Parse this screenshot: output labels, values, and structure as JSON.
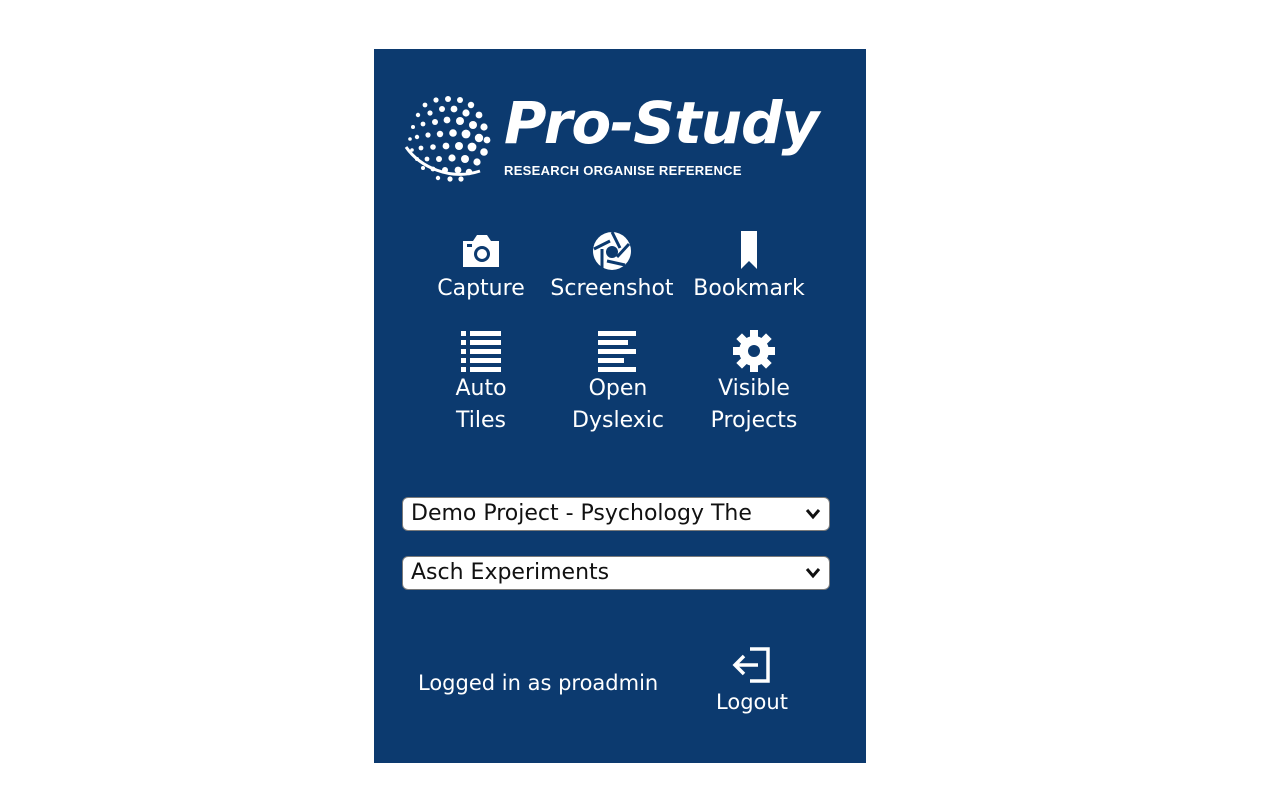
{
  "brand": {
    "title": "Pro-Study",
    "tagline": "RESEARCH ORGANISE REFERENCE"
  },
  "tools": {
    "capture": {
      "label": "Capture",
      "icon": "camera-icon"
    },
    "screenshot": {
      "label": "Screenshot",
      "icon": "aperture-icon"
    },
    "bookmark": {
      "label": "Bookmark",
      "icon": "bookmark-icon"
    },
    "auto_tiles": {
      "label_line1": "Auto",
      "label_line2": "Tiles",
      "icon": "list-icon"
    },
    "open_dyslexic": {
      "label_line1": "Open",
      "label_line2": "Dyslexic",
      "icon": "text-align-icon"
    },
    "visible_projects": {
      "label_line1": "Visible",
      "label_line2": "Projects",
      "icon": "gear-icon"
    }
  },
  "project_select": {
    "value": "Demo Project - Psychology The"
  },
  "topic_select": {
    "value": "Asch Experiments"
  },
  "footer": {
    "status": "Logged in as proadmin",
    "logout_label": "Logout",
    "logout_icon": "logout-icon"
  },
  "colors": {
    "panel_bg": "#0c3a6f",
    "text": "#ffffff"
  }
}
